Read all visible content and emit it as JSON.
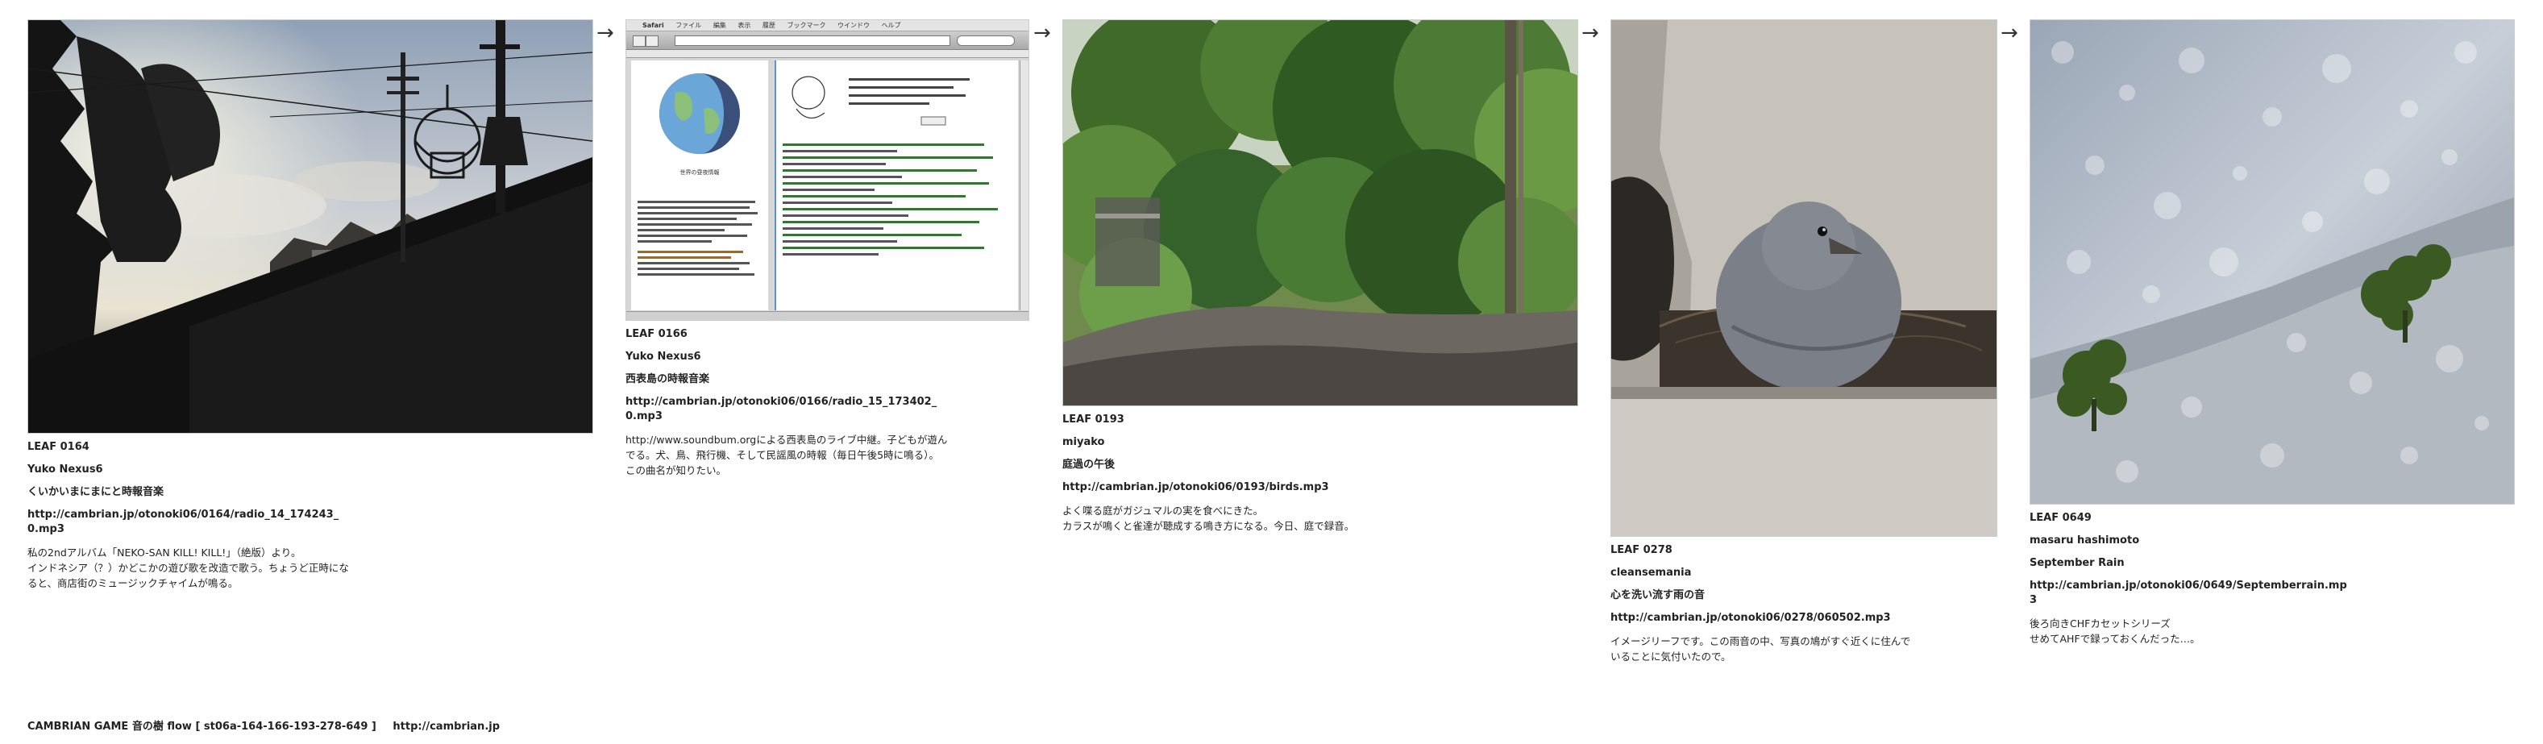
{
  "arrow": "→",
  "leaves": [
    {
      "id": "LEAF 0164",
      "author": "Yuko Nexus6",
      "title": "くいかいまにまにと時報音楽",
      "url": "http://cambrian.jp/otonoki06/0164/radio_14_174243_0.mp3",
      "desc": "私の2ndアルバム「NEKO-SAN KILL! KILL!」（絶版）より。\nインドネシア（？）かどこかの遊び歌を改造で歌う。ちょうど正時になると、商店街のミュージックチャイムが鳴る。",
      "photo": "silhouette-street"
    },
    {
      "id": "LEAF 0166",
      "author": "Yuko Nexus6",
      "title": "西表島の時報音楽",
      "url": "http://cambrian.jp/otonoki06/0166/radio_15_173402_0.mp3",
      "desc": "http://www.soundbum.orgによる西表島のライブ中継。子どもが遊んでる。犬、鳥、飛行機、そして民謡風の時報（毎日午後5時に鳴る）。\nこの曲名が知りたい。",
      "photo": "browser-screenshot"
    },
    {
      "id": "LEAF 0193",
      "author": "miyako",
      "title": "庭過の午後",
      "url": "http://cambrian.jp/otonoki06/0193/birds.mp3",
      "desc": "よく喋る庭がガジュマルの実を食べにきた。\nカラスが鳴くと雀達が聴成する鳴き方になる。今日、庭で録音。",
      "photo": "garden"
    },
    {
      "id": "LEAF 0278",
      "author": "cleansemania",
      "title": "心を洗い流す雨の音",
      "url": "http://cambrian.jp/otonoki06/0278/060502.mp3",
      "desc": "イメージリーフです。この雨音の中、写真の鳩がすぐ近くに住んでいることに気付いたので。",
      "photo": "dove-nest"
    },
    {
      "id": "LEAF 0649",
      "author": "masaru hashimoto",
      "title": "September Rain",
      "url": "http://cambrian.jp/otonoki06/0649/Septemberrain.mp3",
      "desc": "後ろ向きCHFカセットシリーズ\nせめてAHFで録っておくんだった…。",
      "photo": "rain-window"
    }
  ],
  "browser": {
    "menu": [
      "Safari",
      "ファイル",
      "編集",
      "表示",
      "履歴",
      "ブックマーク",
      "ウインドウ",
      "ヘルプ"
    ],
    "globe_caption": "世界の昼夜情報",
    "status": "西表島の時報音楽"
  },
  "footer": {
    "text": "CAMBRIAN GAME 音の樹 flow [ st06a-164-166-193-278-649 ]",
    "link": "http://cambrian.jp"
  },
  "colors": {
    "text": "#222222",
    "background": "#ffffff"
  }
}
